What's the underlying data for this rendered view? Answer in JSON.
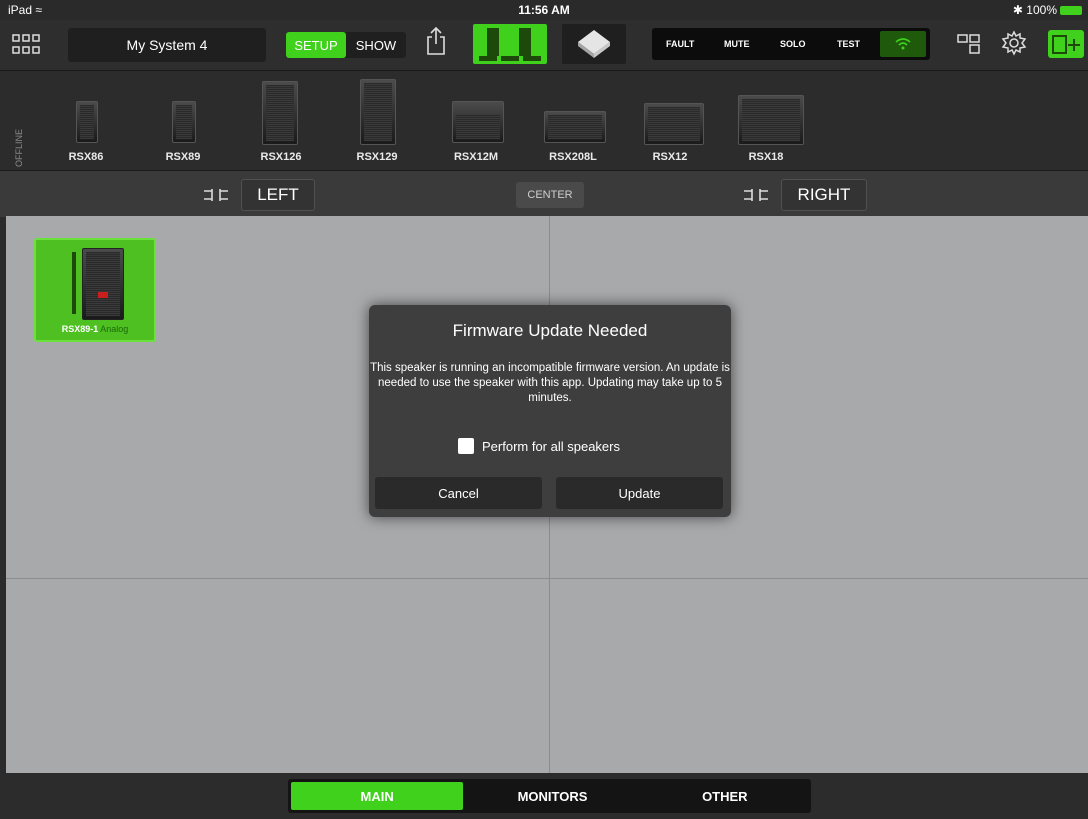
{
  "status": {
    "device": "iPad",
    "time": "11:56 AM",
    "battery": "100%"
  },
  "toolbar": {
    "system_name": "My System 4",
    "mode_setup": "SETUP",
    "mode_show": "SHOW",
    "monitor": [
      "FAULT",
      "MUTE",
      "SOLO",
      "TEST"
    ]
  },
  "palette": {
    "offline_label": "OFFLINE",
    "speakers": [
      "RSX86",
      "RSX89",
      "RSX126",
      "RSX129",
      "RSX12M",
      "RSX208L",
      "RSX12",
      "RSX18"
    ]
  },
  "zones": {
    "left": "LEFT",
    "center": "CENTER",
    "right": "RIGHT"
  },
  "placed_speaker": {
    "name": "RSX89-1",
    "input": "Analog"
  },
  "modal": {
    "title": "Firmware Update Needed",
    "message": "This speaker is running an incompatible firmware version. An update is needed to use the speaker with this app. Updating may take up to 5 minutes.",
    "checkbox_label": "Perform for all speakers",
    "cancel": "Cancel",
    "update": "Update"
  },
  "tabs": [
    "MAIN",
    "MONITORS",
    "OTHER"
  ],
  "colors": {
    "accent": "#3fd11b",
    "grid": "#a8a9ab",
    "modal": "#3e3e3e"
  }
}
